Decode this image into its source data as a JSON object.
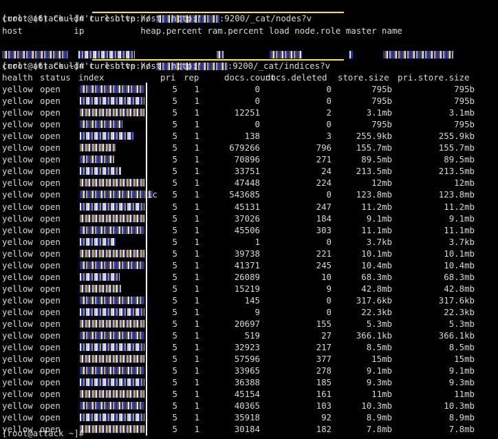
{
  "session": {
    "prompt": "[root@attack ~]# ",
    "cmd1": "curl http://",
    "cmd1_suffix": ":9200/_cat/nodes?v",
    "err1": "curl: (6) Couldn't resolve host 'http:'",
    "nodes_header": "host          ip           heap.percent ram.percent load node.role master name",
    "cmd2": "curl http://",
    "cmd2_suffix": ":9200/_cat/indices?v",
    "err2": "curl: (6) Couldn't resolve host 'http:'",
    "last_prompt": "[root@attack ~]#"
  },
  "table": {
    "headers": [
      "health",
      "status",
      "index",
      "pri",
      "rep",
      "docs.count",
      "docs.deleted",
      "store.size",
      "pri.store.size"
    ],
    "rows": [
      [
        "yellow",
        "open",
        "5",
        "1",
        "0",
        "0",
        "795b",
        "795b"
      ],
      [
        "yellow",
        "open",
        "5",
        "1",
        "0",
        "0",
        "795b",
        "795b"
      ],
      [
        "yellow",
        "open",
        "5",
        "1",
        "12251",
        "2",
        "3.1mb",
        "3.1mb"
      ],
      [
        "yellow",
        "open",
        "5",
        "1",
        "0",
        "0",
        "795b",
        "795b"
      ],
      [
        "yellow",
        "open",
        "5",
        "1",
        "138",
        "3",
        "255.9kb",
        "255.9kb"
      ],
      [
        "yellow",
        "open",
        "5",
        "1",
        "679266",
        "796",
        "155.7mb",
        "155.7mb"
      ],
      [
        "yellow",
        "open",
        "5",
        "1",
        "70896",
        "271",
        "89.5mb",
        "89.5mb"
      ],
      [
        "yellow",
        "open",
        "5",
        "1",
        "33751",
        "24",
        "213.5mb",
        "213.5mb"
      ],
      [
        "yellow",
        "open",
        "5",
        "1",
        "47448",
        "224",
        "12mb",
        "12mb"
      ],
      [
        "yellow",
        "open",
        "5",
        "1",
        "543685",
        "0",
        "123.8mb",
        "123.8mb"
      ],
      [
        "yellow",
        "open",
        "5",
        "1",
        "45131",
        "247",
        "11.2mb",
        "11.2mb"
      ],
      [
        "yellow",
        "open",
        "5",
        "1",
        "37026",
        "184",
        "9.1mb",
        "9.1mb"
      ],
      [
        "yellow",
        "open",
        "5",
        "1",
        "45506",
        "303",
        "11.1mb",
        "11.1mb"
      ],
      [
        "yellow",
        "open",
        "5",
        "1",
        "1",
        "0",
        "3.7kb",
        "3.7kb"
      ],
      [
        "yellow",
        "open",
        "5",
        "1",
        "39738",
        "221",
        "10.1mb",
        "10.1mb"
      ],
      [
        "yellow",
        "open",
        "5",
        "1",
        "41371",
        "245",
        "10.4mb",
        "10.4mb"
      ],
      [
        "yellow",
        "open",
        "5",
        "1",
        "26089",
        "10",
        "68.3mb",
        "68.3mb"
      ],
      [
        "yellow",
        "open",
        "5",
        "1",
        "15219",
        "9",
        "42.8mb",
        "42.8mb"
      ],
      [
        "yellow",
        "open",
        "5",
        "1",
        "145",
        "0",
        "317.6kb",
        "317.6kb"
      ],
      [
        "yellow",
        "open",
        "5",
        "1",
        "9",
        "0",
        "22.3kb",
        "22.3kb"
      ],
      [
        "yellow",
        "open",
        "5",
        "1",
        "20697",
        "155",
        "5.3mb",
        "5.3mb"
      ],
      [
        "yellow",
        "open",
        "5",
        "1",
        "519",
        "27",
        "366.1kb",
        "366.1kb"
      ],
      [
        "yellow",
        "open",
        "5",
        "1",
        "32923",
        "217",
        "8.5mb",
        "8.5mb"
      ],
      [
        "yellow",
        "open",
        "5",
        "1",
        "57596",
        "377",
        "15mb",
        "15mb"
      ],
      [
        "yellow",
        "open",
        "5",
        "1",
        "33965",
        "278",
        "9.1mb",
        "9.1mb"
      ],
      [
        "yellow",
        "open",
        "5",
        "1",
        "36388",
        "185",
        "9.3mb",
        "9.3mb"
      ],
      [
        "yellow",
        "open",
        "5",
        "1",
        "45154",
        "161",
        "11mb",
        "11mb"
      ],
      [
        "yellow",
        "open",
        "5",
        "1",
        "40365",
        "103",
        "10.3mb",
        "10.3mb"
      ],
      [
        "yellow",
        "open",
        "5",
        "1",
        "35918",
        "92",
        "8.9mb",
        "8.9mb"
      ],
      [
        "yellow",
        "open",
        "5",
        "1",
        "30184",
        "182",
        "7.8mb",
        "7.8mb"
      ]
    ],
    "suffix_on_row_10": "ic"
  },
  "colors": {
    "background": "#000000",
    "text": "#d8d8d8",
    "highlight": "#ffee00"
  }
}
